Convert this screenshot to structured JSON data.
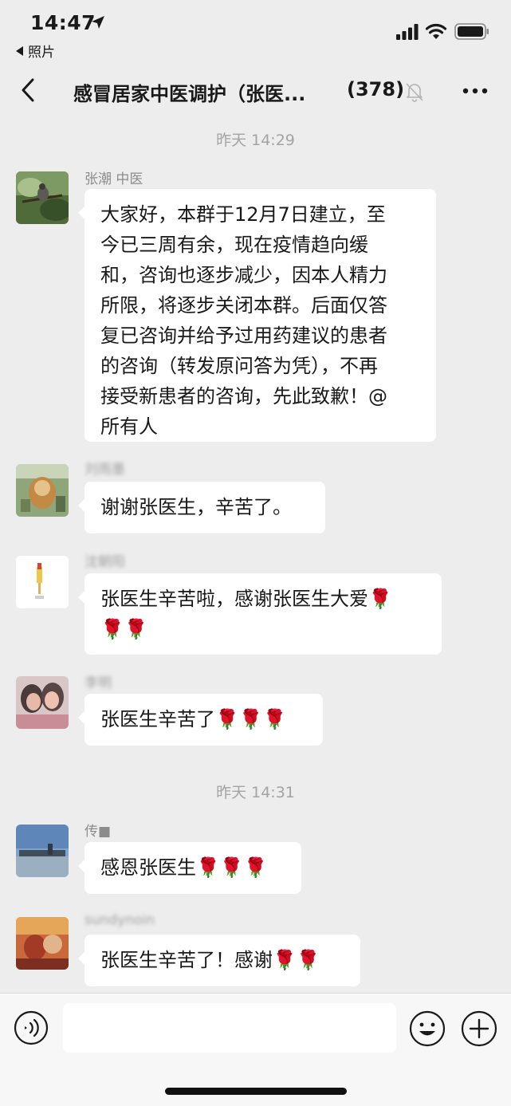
{
  "status_bar": {
    "time": "14:47",
    "back_app_label": "照片",
    "icons": [
      "location-arrow-icon",
      "signal-icon",
      "wifi-icon",
      "battery-icon"
    ]
  },
  "nav": {
    "title": "感冒居家中医调护（张医...",
    "member_count": "(378)",
    "icons": [
      "back-chevron-icon",
      "mute-bell-icon",
      "more-dots-icon"
    ]
  },
  "chat": {
    "timestamp_1": "昨天 14:29",
    "timestamp_2": "昨天 14:31",
    "messages": [
      {
        "sender": "张潮 中医",
        "lines": [
          "大家好，本群于12月7日建立，至",
          "今已三周有余，现在疫情趋向缓",
          "和，咨询也逐步减少，因本人精力",
          "所限，将逐步关闭本群。后面仅答",
          "复已咨询并给予过用药建议的患者",
          "的咨询（转发原问答为凭），不再",
          "接受新患者的咨询，先此致歉！@",
          "所有人"
        ]
      },
      {
        "sender": "刘雨墨",
        "lines": [
          "谢谢张医生，辛苦了。"
        ]
      },
      {
        "sender": "沈朝阳",
        "lines": [
          "张医生辛苦啦，感谢张医生大爱🌹",
          "🌹🌹"
        ]
      },
      {
        "sender": "李明",
        "lines": [
          "张医生辛苦了🌹🌹🌹"
        ]
      },
      {
        "sender": "传■",
        "lines": [
          "感恩张医生🌹🌹🌹"
        ]
      },
      {
        "sender": "sundynoin",
        "lines": [
          "张医生辛苦了！感谢🌹🌹"
        ]
      }
    ]
  },
  "input_bar": {
    "placeholder": "",
    "icons": [
      "voice-icon",
      "emoji-icon",
      "plus-icon"
    ]
  },
  "colors": {
    "background": "#ededed",
    "bubble": "#ffffff",
    "bottom_bar": "#f7f7f7",
    "timestamp": "#a3a3a3"
  }
}
